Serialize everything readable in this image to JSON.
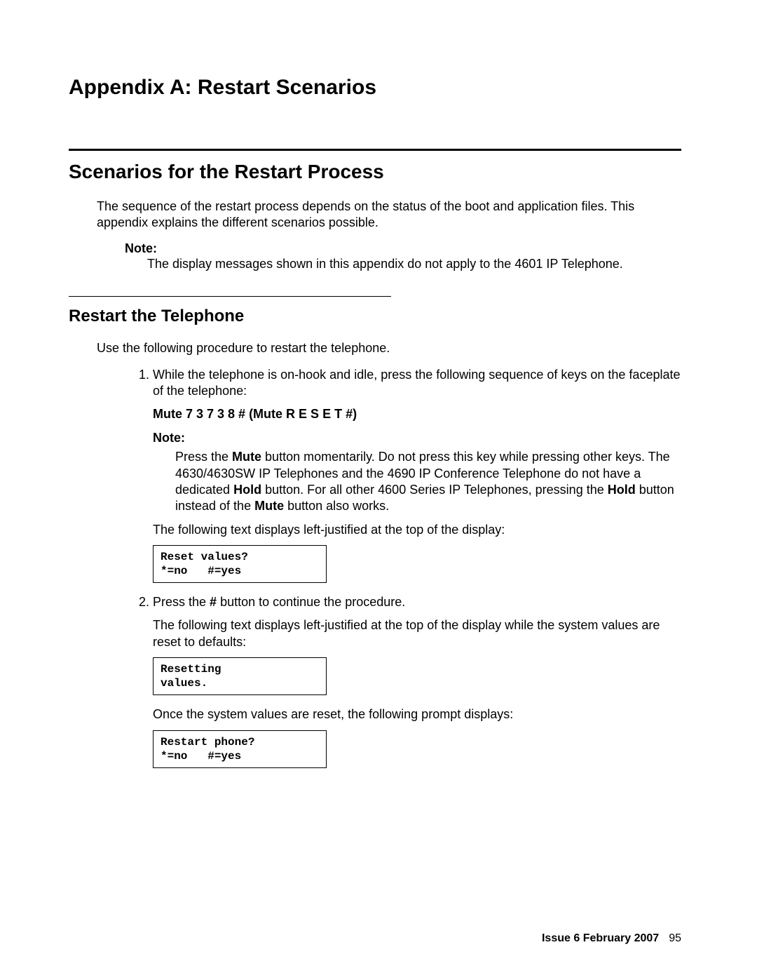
{
  "title": "Appendix A: Restart Scenarios",
  "section": {
    "heading": "Scenarios for the Restart Process",
    "intro": "The sequence of the restart process depends on the status of the boot and application files. This appendix explains the different scenarios possible.",
    "note_label": "Note:",
    "note_body": "The display messages shown in this appendix do not apply to the 4601 IP Telephone."
  },
  "sub": {
    "heading": "Restart the Telephone",
    "intro": "Use the following procedure to restart the telephone.",
    "step1": {
      "text": "While the telephone is on-hook and idle, press the following sequence of keys on the faceplate of the telephone:",
      "keyseq": "Mute 7 3 7 3 8 # (Mute R E S E T #)",
      "note_label": "Note:",
      "note_pre": "Press the ",
      "note_b1": "Mute",
      "note_mid1": " button momentarily. Do not press this key while pressing other keys. The 4630/4630SW IP Telephones and the 4690 IP Conference Telephone do not have a dedicated ",
      "note_b2": "Hold",
      "note_mid2": " button. For all other 4600 Series IP Telephones, pressing the ",
      "note_b3": "Hold",
      "note_mid3": " button instead of the ",
      "note_b4": "Mute",
      "note_post": " button also works.",
      "after_note": "The following text displays left-justified at the top of the display:",
      "display": "Reset values?\n*=no   #=yes"
    },
    "step2": {
      "pre": "Press the ",
      "b1": "#",
      "post": " button to continue the procedure.",
      "after1": "The following text displays left-justified at the top of the display while the system values are reset to defaults:",
      "display1": "Resetting\nvalues.",
      "after2": "Once the system values are reset, the following prompt displays:",
      "display2": "Restart phone?\n*=no   #=yes"
    }
  },
  "footer": {
    "issue": "Issue 6   February 2007",
    "page": "95"
  }
}
